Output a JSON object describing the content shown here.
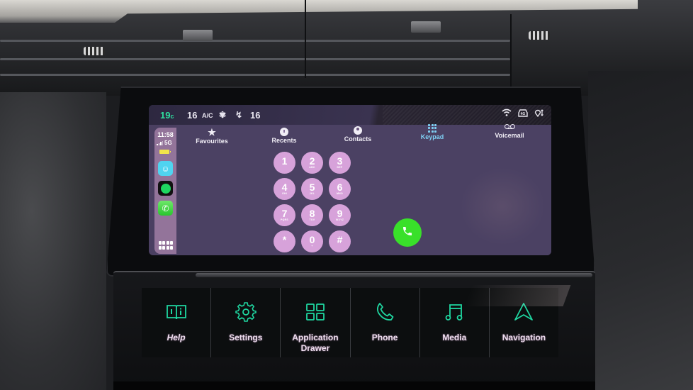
{
  "climate": {
    "outside_temp": "19",
    "outside_temp_unit": "c",
    "left_temp": "16",
    "ac_label": "A/C",
    "fan_icon": "fan-icon",
    "seat_airflow_icon": "seat-airflow-icon",
    "right_temp": "16"
  },
  "system_icons": [
    "wifi-icon",
    "connected-car-icon",
    "location-sharing-icon"
  ],
  "carplay_sidebar": {
    "time": "11:58",
    "network": "5G",
    "battery_color": "#f3e34a",
    "apps": [
      {
        "name": "Waze",
        "icon": "waze-icon",
        "color": "#4fd4f0"
      },
      {
        "name": "Spotify",
        "icon": "spotify-icon",
        "color": "#1ed760"
      },
      {
        "name": "Phone",
        "icon": "phone-icon",
        "color": "#33cc33"
      }
    ],
    "home_icon": "app-grid-icon"
  },
  "phone_app": {
    "tabs": [
      {
        "label": "Favourites",
        "icon": "star-icon",
        "active": false
      },
      {
        "label": "Recents",
        "icon": "clock-icon",
        "active": false
      },
      {
        "label": "Contacts",
        "icon": "person-icon",
        "active": false
      },
      {
        "label": "Keypad",
        "icon": "keypad-icon",
        "active": true
      },
      {
        "label": "Voicemail",
        "icon": "voicemail-icon",
        "active": false
      }
    ],
    "active_color": "#7fd0f4",
    "keys": [
      {
        "digit": "1",
        "letters": ""
      },
      {
        "digit": "2",
        "letters": "ABC"
      },
      {
        "digit": "3",
        "letters": "DEF"
      },
      {
        "digit": "4",
        "letters": "GHI"
      },
      {
        "digit": "5",
        "letters": "JKL"
      },
      {
        "digit": "6",
        "letters": "MNO"
      },
      {
        "digit": "7",
        "letters": "PQRS"
      },
      {
        "digit": "8",
        "letters": "TUV"
      },
      {
        "digit": "9",
        "letters": "WXYZ"
      },
      {
        "digit": "*",
        "letters": ""
      },
      {
        "digit": "0",
        "letters": "+"
      },
      {
        "digit": "#",
        "letters": ""
      }
    ],
    "key_color": "#d7a2da",
    "call_button_color": "#39e02a",
    "call_icon": "phone-handset-icon"
  },
  "touch_panel": {
    "accent_color": "#1fd6a0",
    "buttons": [
      {
        "label": "Help",
        "icon": "help-book-icon"
      },
      {
        "label": "Settings",
        "icon": "gear-icon"
      },
      {
        "label": "Application Drawer",
        "icon": "app-grid-icon"
      },
      {
        "label": "Phone",
        "icon": "phone-icon"
      },
      {
        "label": "Media",
        "icon": "music-note-icon"
      },
      {
        "label": "Navigation",
        "icon": "navigation-arrow-icon"
      }
    ]
  }
}
